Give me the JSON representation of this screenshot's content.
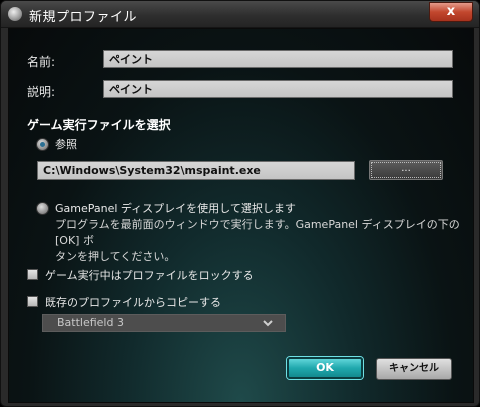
{
  "window": {
    "title": "新規プロファイル",
    "close_glyph": "x"
  },
  "form": {
    "name_label": "名前:",
    "name_value": "ペイント",
    "desc_label": "説明:",
    "desc_value": "ペイント"
  },
  "exe_section": {
    "title": "ゲーム実行ファイルを選択",
    "browse_option_label": "参照",
    "path_value": "C:\\Windows\\System32\\mspaint.exe",
    "browse_button_label": "...",
    "gamepanel_option_label": "GamePanel ディスプレイを使用して選択します",
    "gamepanel_desc_line1": "プログラムを最前面のウィンドウで実行します。GamePanel ディスプレイの下の [OK] ボ",
    "gamepanel_desc_line2": "タンを押してください。"
  },
  "options": {
    "lock_label": "ゲーム実行中はプロファイルをロックする",
    "copy_label": "既存のプロファイルからコピーする",
    "copy_source_selected": "Battlefield 3"
  },
  "buttons": {
    "ok": "OK",
    "cancel": "キャンセル"
  },
  "colors": {
    "accent": "#20a9ae",
    "titlebar": "#2e2e2e",
    "close": "#c2472e"
  },
  "icons": {
    "app": "logitech-icon",
    "dropdown": "chevron-down-icon"
  }
}
